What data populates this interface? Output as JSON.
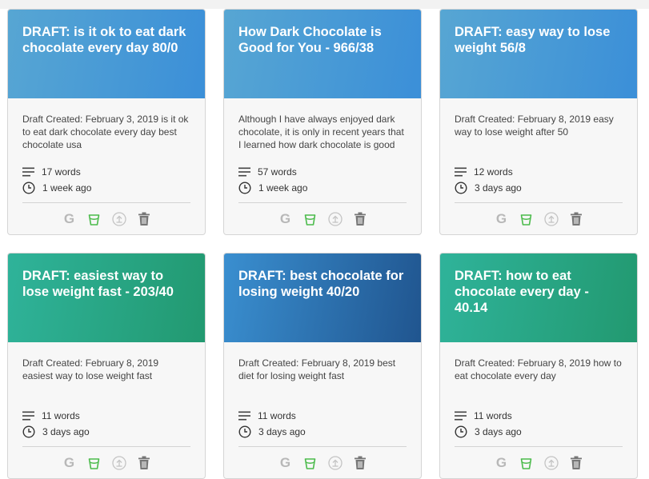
{
  "cards": [
    {
      "title": "DRAFT: is it ok to eat dark chocolate every day 80/0",
      "header_style": "blue",
      "excerpt": "Draft Created: February 3, 2019 is it ok to eat dark chocolate every day best chocolate usa",
      "words": "17 words",
      "time": "1 week ago"
    },
    {
      "title": "How Dark Chocolate is Good for You - 966/38",
      "header_style": "blue",
      "excerpt": "Although I have always enjoyed dark chocolate, it is only in recent years that I learned how dark chocolate is good",
      "words": "57 words",
      "time": "1 week ago"
    },
    {
      "title": "DRAFT: easy way to lose weight 56/8",
      "header_style": "blue",
      "excerpt": "Draft Created: February 8, 2019 easy way to lose weight after 50",
      "words": "12 words",
      "time": "3 days ago"
    },
    {
      "title": "DRAFT: easiest way to lose weight fast - 203/40",
      "header_style": "green",
      "excerpt": "Draft Created: February 8, 2019 easiest way to lose weight fast",
      "words": "11 words",
      "time": "3 days ago"
    },
    {
      "title": "DRAFT: best chocolate for losing weight 40/20",
      "header_style": "darkblue",
      "excerpt": "Draft Created: February 8, 2019 best diet for losing weight fast",
      "words": "11 words",
      "time": "3 days ago"
    },
    {
      "title": "DRAFT: how to eat chocolate every day - 40.14",
      "header_style": "green",
      "excerpt": "Draft Created: February 8, 2019 how to eat chocolate every day",
      "words": "11 words",
      "time": "3 days ago"
    }
  ],
  "icons": {
    "google": "G",
    "cup": "cup-icon",
    "upload": "upload-icon",
    "trash": "trash-icon",
    "words": "lines-icon",
    "time": "clock-icon"
  },
  "colors": {
    "header_blue": "#3b8fd8",
    "header_green": "#229970",
    "header_darkblue": "#20558f",
    "cup_green": "#4cbb4c"
  }
}
